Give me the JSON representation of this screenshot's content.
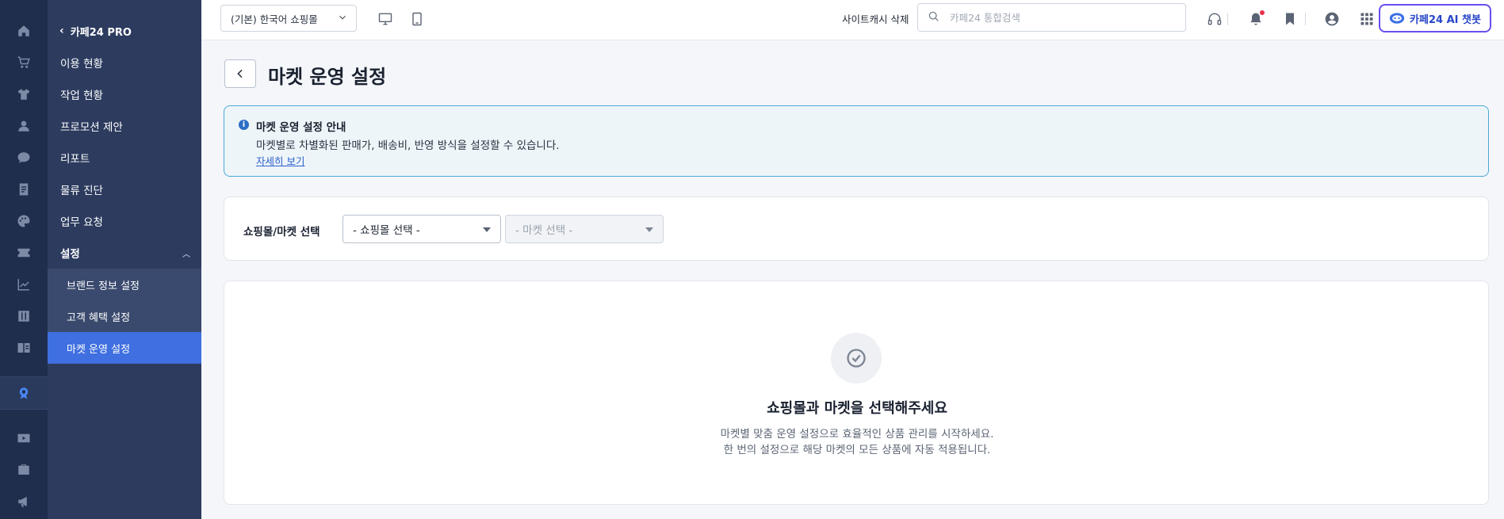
{
  "rail": {
    "icons": [
      "home-icon",
      "cart-icon",
      "shirt-icon",
      "user-icon",
      "chat-icon",
      "board-icon",
      "palette-icon",
      "ticket-icon",
      "stats-icon",
      "columns-icon",
      "store-icon",
      "award-icon",
      "video-icon",
      "briefcase-icon",
      "megaphone-icon"
    ],
    "active": "award-icon"
  },
  "subnav": {
    "back_label": "카페24 PRO",
    "items": [
      "이용 현황",
      "작업 현황",
      "프로모션 제안",
      "리포트",
      "물류 진단",
      "업무 요청"
    ],
    "group_label": "설정",
    "children": [
      "브랜드 정보 설정",
      "고객 혜택 설정",
      "마켓 운영 설정"
    ],
    "active_child": "마켓 운영 설정"
  },
  "topbar": {
    "shop_select": "(기본) 한국어 쇼핑몰",
    "cache_link": "사이트캐시 삭제",
    "search_placeholder": "카페24 통합검색",
    "ai_button": "카페24 AI 챗봇"
  },
  "page": {
    "title": "마켓 운영 설정",
    "info": {
      "title": "마켓 운영 설정 안내",
      "desc": "마켓별로 차별화된 판매가, 배송비, 반영 방식을 설정할 수 있습니다.",
      "link": "자세히 보기"
    },
    "filter": {
      "label": "쇼핑몰/마켓 선택",
      "shop_select": "- 쇼핑몰 선택 -",
      "market_select": "- 마켓 선택 -"
    },
    "empty": {
      "title": "쇼핑몰과 마켓을 선택해주세요",
      "line1": "마켓별 맞춤 운영 설정으로 효율적인 상품 관리를 시작하세요.",
      "line2": "한 번의 설정으로 해당 마켓의 모든 상품에 자동 적용됩니다."
    }
  },
  "colors": {
    "rail_bg": "#1f2e4d",
    "subnav_bg": "#2c3b5e",
    "active_blue": "#3f6fe0",
    "info_border": "#4aa8d8",
    "ai_border": "#6a4ef0"
  }
}
